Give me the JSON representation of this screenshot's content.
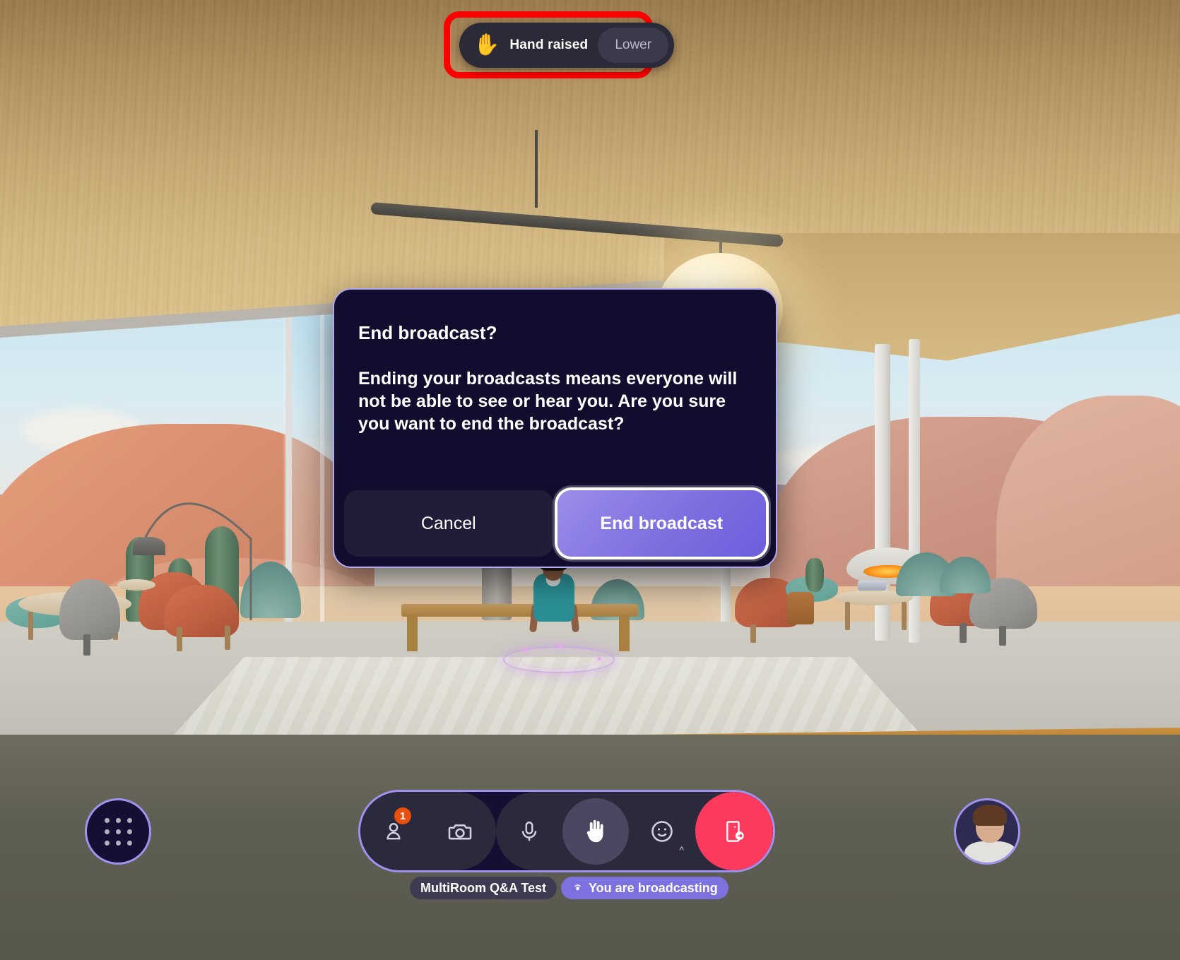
{
  "hand_toast": {
    "emoji": "✋",
    "label": "Hand raised",
    "lower_button": "Lower",
    "highlight_color": "#ff0000"
  },
  "dialog": {
    "title": "End broadcast?",
    "message": "Ending your broadcasts means everyone will not be able to see or hear you. Are you sure you want to end the broadcast?",
    "cancel_label": "Cancel",
    "confirm_label": "End broadcast",
    "accent_color": "#7e6fe0",
    "border_color": "#b3aaf0",
    "background_color": "#120d2e"
  },
  "toolbar": {
    "apps_button_name": "apps-grid",
    "buttons": [
      {
        "name": "people",
        "icon": "people-icon",
        "badge": "1"
      },
      {
        "name": "camera",
        "icon": "camera-icon",
        "badge": ""
      },
      {
        "name": "microphone",
        "icon": "microphone-icon",
        "badge": ""
      },
      {
        "name": "raise-hand",
        "icon": "hand-icon",
        "badge": "",
        "active": true
      },
      {
        "name": "reactions",
        "icon": "smiley-icon",
        "badge": "",
        "chevron": "^"
      },
      {
        "name": "leave",
        "icon": "leave-door-icon",
        "badge": ""
      }
    ],
    "accent_border": "#9f93ef",
    "leave_color": "#fb3a5d",
    "badge_color": "#e8500f"
  },
  "status": {
    "room_name": "MultiRoom Q&A Test",
    "broadcast_icon": "broadcast-icon",
    "broadcast_label": "You are broadcasting",
    "broadcast_chip_color": "#7d71e0"
  }
}
